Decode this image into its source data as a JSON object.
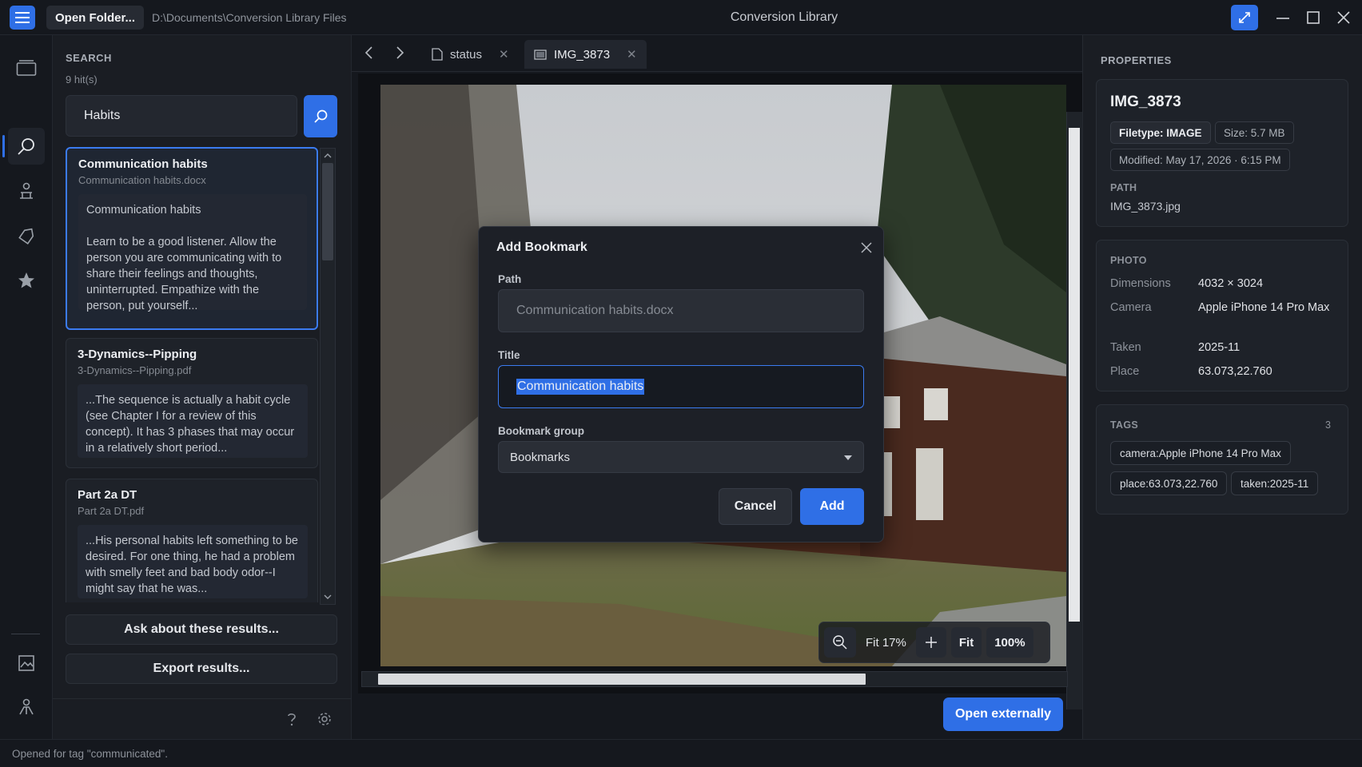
{
  "titlebar": {
    "open_folder_label": "Open Folder...",
    "path": "D:\\Documents\\Conversion Library Files",
    "app_title": "Conversion Library"
  },
  "rail": {
    "top_icons": [
      "library-icon",
      "search-icon",
      "assistant-icon",
      "tag-icon",
      "star-icon"
    ],
    "bottom_icons": [
      "image-gallery-icon",
      "user-icon"
    ],
    "active": "search-icon"
  },
  "search": {
    "section_label": "SEARCH",
    "hits": "9 hit(s)",
    "query": "Habits",
    "results": [
      {
        "title": "Communication habits",
        "file": "Communication habits.docx",
        "snippet": "Communication  habits\n\nLearn to be a good listener.  Allow the person you are communicating with to share their feelings and thoughts, uninterrupted.  Empathize with the person, put yourself..."
      },
      {
        "title": "3-Dynamics--Pipping",
        "file": "3-Dynamics--Pipping.pdf",
        "snippet": "...The sequence is actually a habit cycle (see Chapter I for a review of this concept). It has 3 phases that may occur in a relatively short period..."
      },
      {
        "title": "Part 2a DT",
        "file": "Part 2a DT.pdf",
        "snippet": "...His personal habits left something to be desired.  For one thing, he had a problem with smelly feet and bad body odor--I might say that he was..."
      }
    ],
    "ask_label": "Ask about these results...",
    "export_label": "Export results..."
  },
  "viewer": {
    "tabs": [
      {
        "label": "status",
        "icon": "document-icon"
      },
      {
        "label": "IMG_3873",
        "icon": "image-icon"
      }
    ],
    "zoom": {
      "fit_percent_label": "Fit 17%",
      "fit_label": "Fit",
      "full_label": "100%"
    },
    "open_externally_label": "Open externally"
  },
  "dialog": {
    "title": "Add Bookmark",
    "path_label": "Path",
    "path_placeholder": "Communication habits.docx",
    "title_label": "Title",
    "title_value": "Communication habits",
    "group_label": "Bookmark group",
    "group_value": "Bookmarks",
    "cancel_label": "Cancel",
    "add_label": "Add"
  },
  "properties": {
    "section_label": "PROPERTIES",
    "name": "IMG_3873",
    "filetype": "Filetype: IMAGE",
    "size": "Size: 5.7 MB",
    "modified": "Modified: May 17, 2026 · 6:15 PM",
    "path_label": "PATH",
    "path": "IMG_3873.jpg",
    "photo_label": "PHOTO",
    "photo": [
      {
        "key": "Dimensions",
        "value": "4032 × 3024"
      },
      {
        "key": "Camera",
        "value": "Apple iPhone 14 Pro Max"
      },
      {
        "key": "Taken",
        "value": "2025-11"
      },
      {
        "key": "Place",
        "value": "63.073,22.760"
      }
    ],
    "tags_label": "TAGS",
    "tags_count": "3",
    "tags": [
      "camera:Apple iPhone 14 Pro Max",
      "place:63.073,22.760",
      "taken:2025-11"
    ]
  },
  "status": {
    "message": "Opened for tag \"communicated\"."
  },
  "colors": {
    "accent": "#2f6fe6",
    "background": "#15181e",
    "panel": "#1a1d23"
  }
}
